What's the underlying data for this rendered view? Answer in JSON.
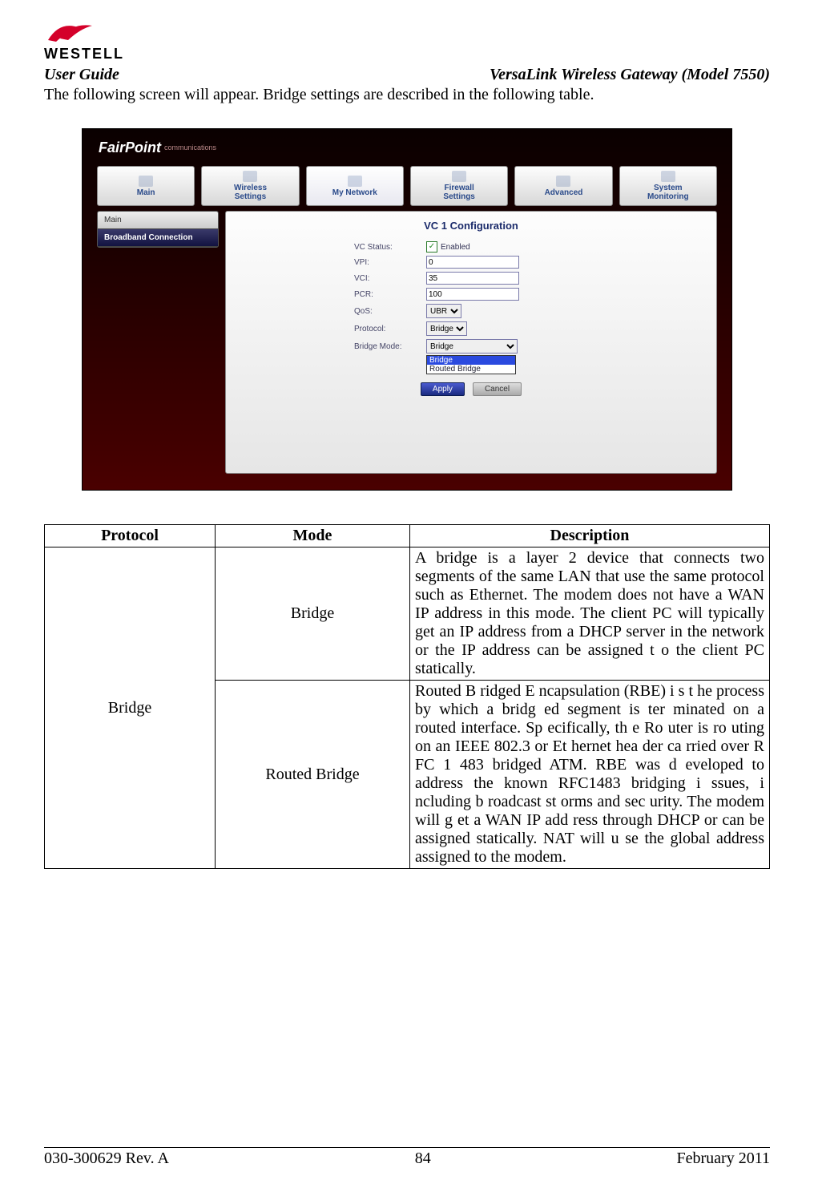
{
  "header": {
    "logo_brand": "WESTELL",
    "left": "User Guide",
    "right": "VersaLink Wireless Gateway (Model 7550)"
  },
  "intro": "The following screen will appear. Bridge settings are described in the following table.",
  "screenshot": {
    "brand_main": "FairPoint",
    "brand_sub": "communications",
    "nav": {
      "main": "Main",
      "wireless": "Wireless\nSettings",
      "mynetwork": "My Network",
      "firewall": "Firewall\nSettings",
      "advanced": "Advanced",
      "system": "System\nMonitoring"
    },
    "sidebar": {
      "item0": "Main",
      "item1": "Broadband Connection"
    },
    "panel_title": "VC 1 Configuration",
    "form": {
      "vc_status_label": "VC Status:",
      "vc_status_value": "Enabled",
      "vpi_label": "VPI:",
      "vpi_value": "0",
      "vci_label": "VCI:",
      "vci_value": "35",
      "pcr_label": "PCR:",
      "pcr_value": "100",
      "qos_label": "QoS:",
      "qos_value": "UBR",
      "protocol_label": "Protocol:",
      "protocol_value": "Bridge",
      "bridgemode_label": "Bridge Mode:",
      "bridgemode_value": "Bridge",
      "dropdown_opt1": "Bridge",
      "dropdown_opt2": "Routed Bridge"
    },
    "buttons": {
      "apply": "Apply",
      "cancel": "Cancel"
    }
  },
  "table": {
    "headers": {
      "protocol": "Protocol",
      "mode": "Mode",
      "description": "Description"
    },
    "protocol_cell": "Bridge",
    "row1_mode": "Bridge",
    "row1_desc": "A bridge is a layer 2 device that connects two segments of the same LAN that use the same protocol such as Ethernet. The modem does not have a WAN IP address in this mode. The client PC will typically get an IP address from a DHCP server in the network or the IP address can be assigned t o the client PC statically.",
    "row2_mode": "Routed Bridge",
    "row2_desc": "Routed B ridged E ncapsulation  (RBE) i s t he  process  by which a bridg   ed   segment is ter    minated on   a     routed interface. Sp ecifically, th e Ro uter is ro  uting  on an   IEEE 802.3  or Et hernet hea der ca rried  over R FC 1 483  bridged ATM. RBE was d eveloped to address the known RFC1483 bridging i ssues, i ncluding b roadcast st orms and sec  urity. The modem will g et a  WAN IP add ress through DHCP or can be assigned statically. NAT will u se the global address assigned to the modem."
  },
  "footer": {
    "left": "030-300629 Rev. A",
    "center": "84",
    "right": "February 2011"
  }
}
